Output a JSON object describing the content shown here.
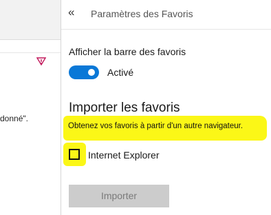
{
  "background_page": {
    "fragment_text": "donné\"."
  },
  "panel": {
    "title": "Paramètres des Favoris",
    "back_icon": "chevron-double-left-icon",
    "favorites_bar": {
      "label": "Afficher la barre des favoris",
      "toggle_state": "Activé",
      "toggle_on": true,
      "toggle_color": "#0a78d7"
    },
    "import": {
      "heading": "Importer les favoris",
      "description": "Obtenez vos favoris à partir d'un autre navigateur.",
      "browsers": [
        {
          "label": "Internet Explorer",
          "checked": false
        }
      ],
      "button_label": "Importer"
    }
  },
  "colors": {
    "highlight": "#fbf717",
    "button_disabled": "#cccccc",
    "alert_icon": "#c2185b"
  }
}
